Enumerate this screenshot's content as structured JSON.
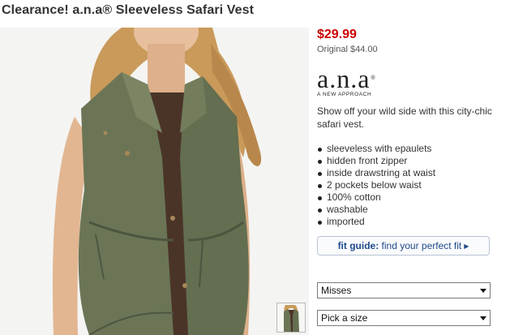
{
  "product": {
    "title": "Clearance! a.n.a® Sleeveless Safari Vest",
    "price": "$29.99",
    "original_price": "Original $44.00",
    "brand": {
      "name": "a.n.a",
      "registered": "®",
      "tagline": "A NEW APPROACH"
    },
    "description": "Show off your wild side with this city-chic safari vest.",
    "features": [
      "sleeveless with epaulets",
      "hidden front zipper",
      "inside drawstring at waist",
      "2 pockets below waist",
      "100% cotton",
      "washable",
      "imported"
    ]
  },
  "fit_guide": {
    "strong": "fit guide:",
    "text": " find your perfect fit"
  },
  "selects": {
    "type": {
      "value": "Misses"
    },
    "size": {
      "value": "Pick a size"
    }
  },
  "colors": {
    "price": "#cc0000",
    "link": "#1f4a8a",
    "vest": "#6b7556",
    "shirt": "#4a3428"
  }
}
